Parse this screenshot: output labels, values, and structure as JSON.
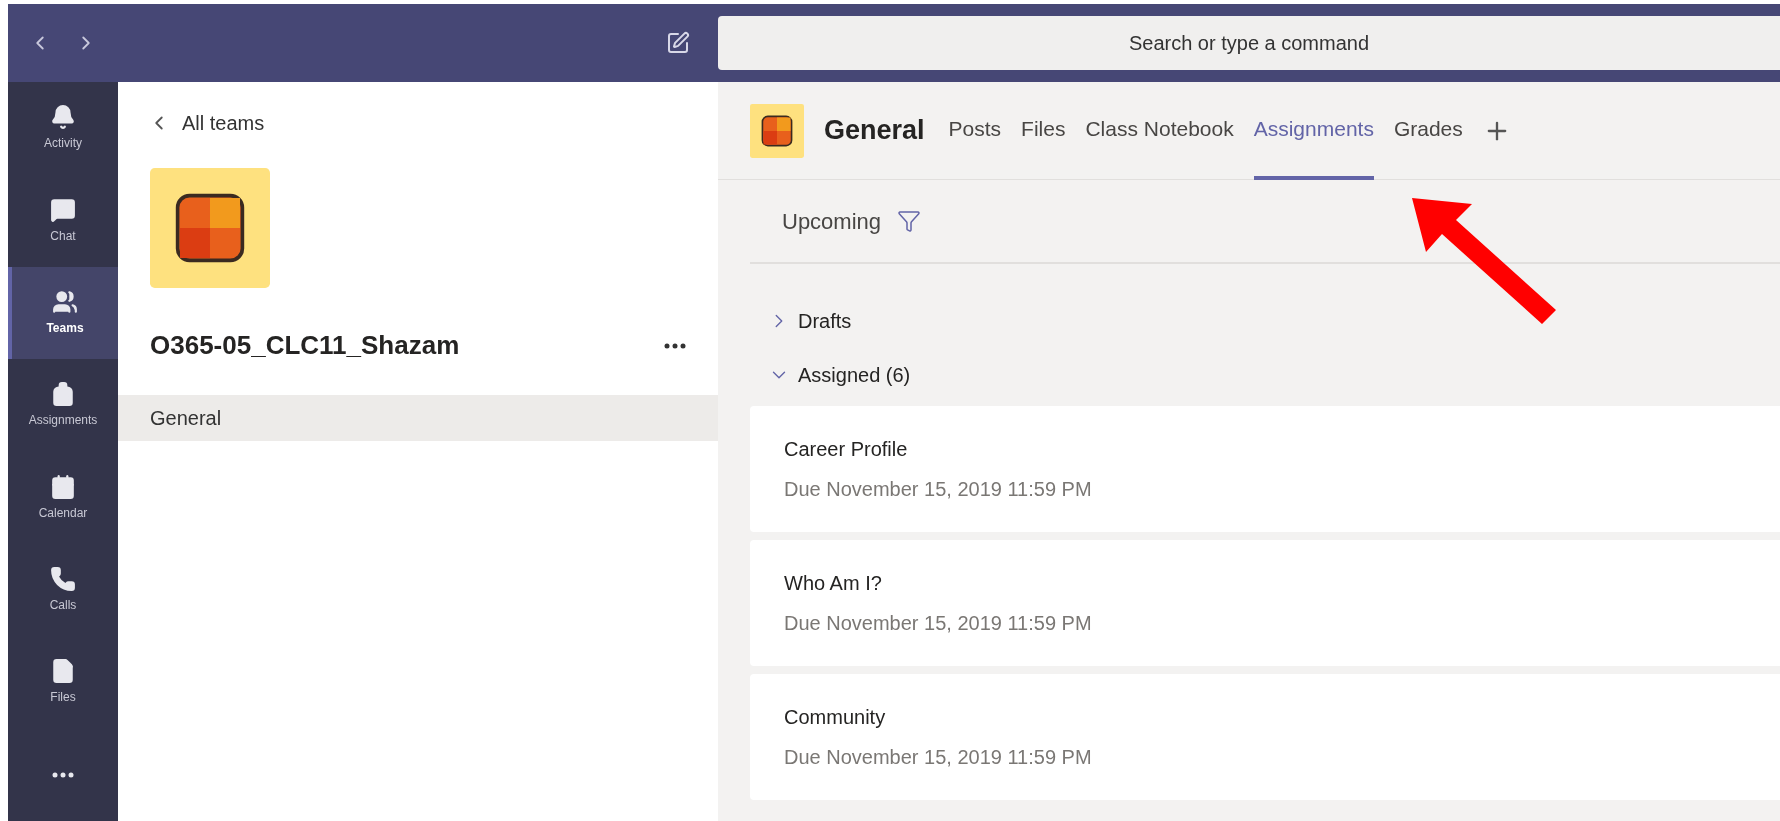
{
  "search": {
    "placeholder": "Search or type a command"
  },
  "rail": [
    {
      "kind": "bell",
      "label": "Activity",
      "selected": false
    },
    {
      "kind": "chat",
      "label": "Chat",
      "selected": false
    },
    {
      "kind": "teams",
      "label": "Teams",
      "selected": true
    },
    {
      "kind": "backpack",
      "label": "Assignments",
      "selected": false
    },
    {
      "kind": "calendar",
      "label": "Calendar",
      "selected": false
    },
    {
      "kind": "phone",
      "label": "Calls",
      "selected": false
    },
    {
      "kind": "file",
      "label": "Files",
      "selected": false
    },
    {
      "kind": "more",
      "selected": false
    }
  ],
  "sidebar": {
    "back_link": "All teams",
    "team_name": "O365-05_CLC11_Shazam",
    "channels": [
      {
        "label": "General",
        "selected": true
      }
    ]
  },
  "channel": {
    "title": "General",
    "tabs": [
      {
        "label": "Posts",
        "selected": false
      },
      {
        "label": "Files",
        "selected": false
      },
      {
        "label": "Class Notebook",
        "selected": false
      },
      {
        "label": "Assignments",
        "selected": true
      },
      {
        "label": "Grades",
        "selected": false
      }
    ]
  },
  "assignments": {
    "filter_label": "Upcoming",
    "sections": [
      {
        "title": "Drafts",
        "expanded": false
      },
      {
        "title": "Assigned (6)",
        "expanded": true,
        "items": [
          {
            "title": "Career Profile",
            "due": "Due November 15, 2019 11:59 PM"
          },
          {
            "title": "Who Am I?",
            "due": "Due November 15, 2019 11:59 PM"
          },
          {
            "title": "Community",
            "due": "Due November 15, 2019 11:59 PM"
          }
        ]
      }
    ]
  }
}
